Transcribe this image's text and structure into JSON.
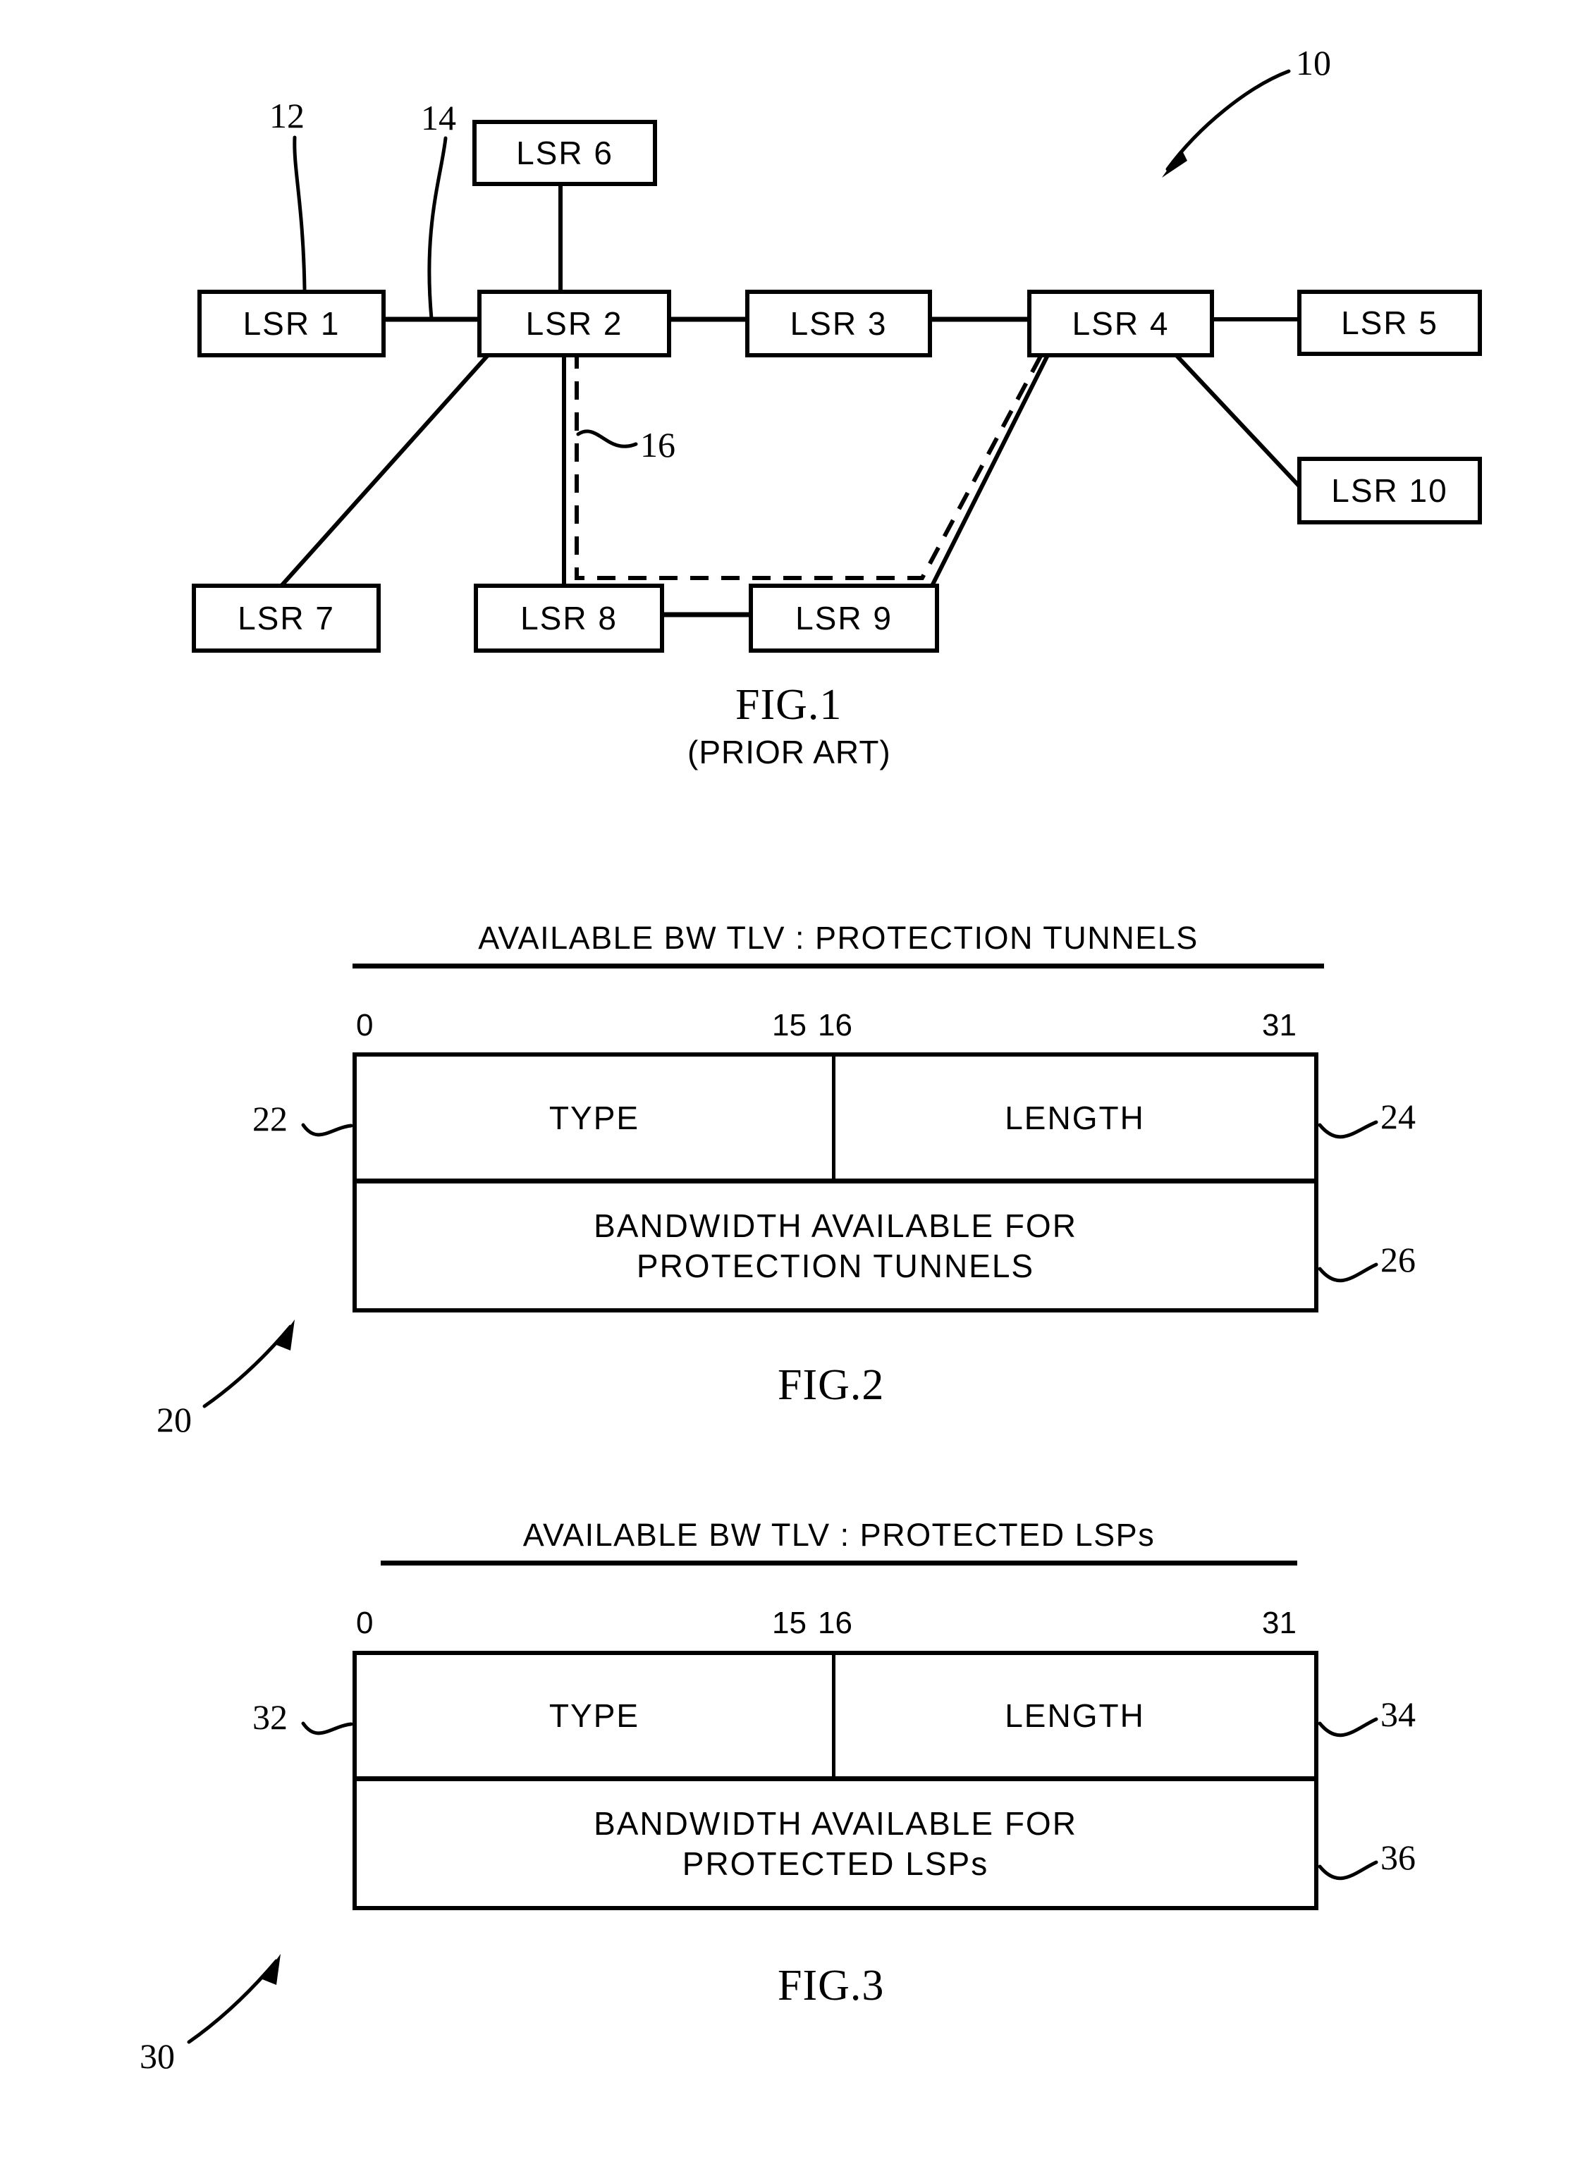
{
  "figure1": {
    "caption": "FIG.1",
    "subcaption": "(PRIOR ART)",
    "nodes": [
      {
        "id": "lsr6",
        "label": "LSR  6"
      },
      {
        "id": "lsr1",
        "label": "LSR  1"
      },
      {
        "id": "lsr2",
        "label": "LSR  2"
      },
      {
        "id": "lsr3",
        "label": "LSR  3"
      },
      {
        "id": "lsr4",
        "label": "LSR  4"
      },
      {
        "id": "lsr5",
        "label": "LSR  5"
      },
      {
        "id": "lsr10",
        "label": "LSR  10"
      },
      {
        "id": "lsr7",
        "label": "LSR  7"
      },
      {
        "id": "lsr8",
        "label": "LSR  8"
      },
      {
        "id": "lsr9",
        "label": "LSR  9"
      }
    ],
    "refs": {
      "network": "10",
      "node": "12",
      "link": "14",
      "tunnel": "16"
    }
  },
  "figure2": {
    "caption": "FIG.2",
    "title": "AVAILABLE BW TLV : PROTECTION TUNNELS",
    "bits": {
      "start": "0",
      "mid_left": "15",
      "mid_right": "16",
      "end": "31"
    },
    "cells": {
      "type": "TYPE",
      "length": "LENGTH",
      "payload_line1": "BANDWIDTH AVAILABLE FOR",
      "payload_line2": "PROTECTION TUNNELS"
    },
    "refs": {
      "tlv": "20",
      "type": "22",
      "length": "24",
      "payload": "26"
    }
  },
  "figure3": {
    "caption": "FIG.3",
    "title": "AVAILABLE BW TLV : PROTECTED LSPs",
    "bits": {
      "start": "0",
      "mid_left": "15",
      "mid_right": "16",
      "end": "31"
    },
    "cells": {
      "type": "TYPE",
      "length": "LENGTH",
      "payload_line1": "BANDWIDTH AVAILABLE FOR",
      "payload_line2": "PROTECTED LSPs"
    },
    "refs": {
      "tlv": "30",
      "type": "32",
      "length": "34",
      "payload": "36"
    }
  },
  "colors": {
    "ink": "#000000",
    "paper": "#ffffff"
  }
}
